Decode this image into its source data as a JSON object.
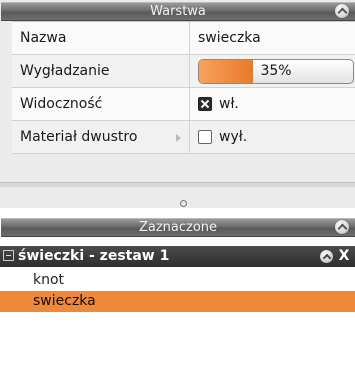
{
  "layer_panel": {
    "title": "Warstwa",
    "properties": [
      {
        "label": "Nazwa",
        "value": "swieczka"
      },
      {
        "label": "Wygładzanie",
        "value": "35%",
        "level": 0.35
      },
      {
        "label": "Widoczność",
        "value": "wł.",
        "checked": true
      },
      {
        "label": "Materiał dwustro",
        "value": "wył.",
        "checked": false
      }
    ]
  },
  "selection_panel": {
    "title": "Zaznaczone",
    "group": {
      "name": "świeczki - zestaw 1",
      "close_glyph": "X"
    },
    "items": [
      {
        "label": "knot",
        "selected": false
      },
      {
        "label": "swieczka",
        "selected": true
      }
    ]
  },
  "colors": {
    "accent": "#f0883a",
    "slider_fill": "#ee8c3d",
    "title_bar": "#6e6e6e",
    "group_header": "#333333"
  },
  "icons": [
    "collapse-panel-icon",
    "expand-arrow-icon",
    "checkbox-checked-icon",
    "checkbox-unchecked-icon",
    "tree-collapse-icon",
    "close-icon",
    "splitter-grip-icon"
  ]
}
